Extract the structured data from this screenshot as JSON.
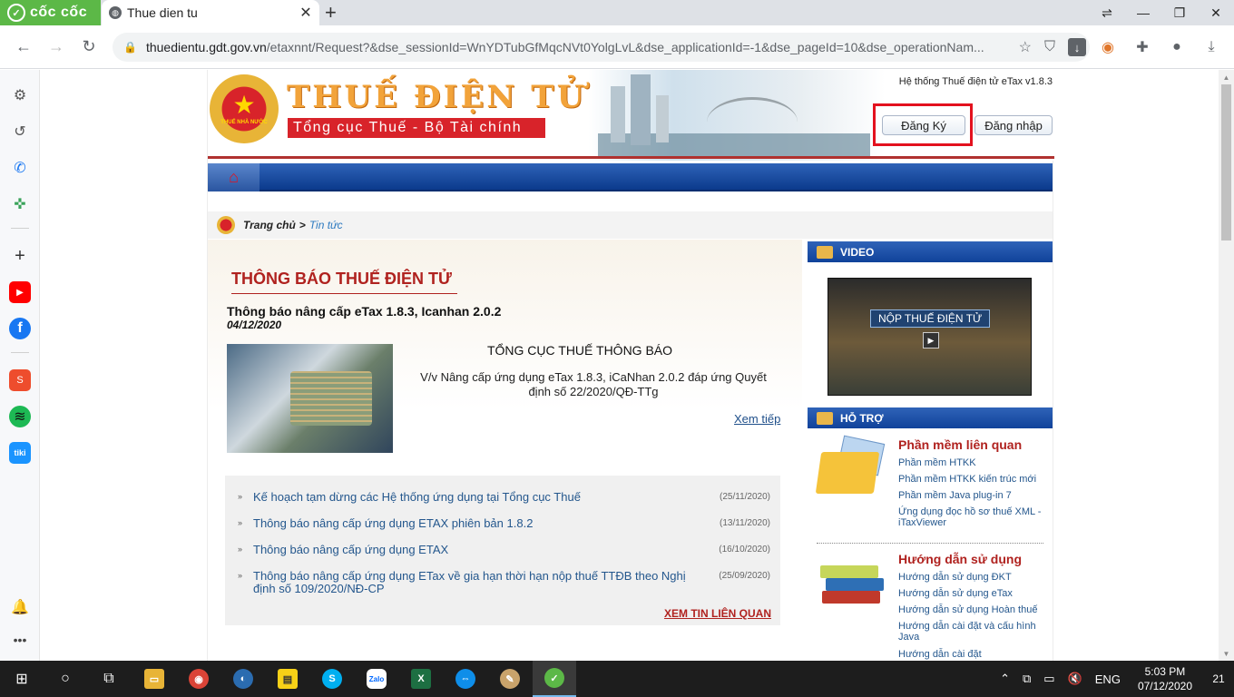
{
  "browser": {
    "brand": "cốc cốc",
    "tab_title": "Thue dien tu",
    "url_host": "thuedientu.gdt.gov.vn",
    "url_path": "/etaxnnt/Request?&dse_sessionId=WnYDTubGfMqcNVt0YolgLvL&dse_applicationId=-1&dse_pageId=10&dse_operationNam..."
  },
  "header": {
    "emblem_text": "THUẾ NHÀ NƯỚC",
    "site_title": "THUẾ ĐIỆN TỬ",
    "site_subtitle": "Tổng cục Thuế - Bộ Tài chính",
    "system_version": "Hệ thống Thuế điện tử eTax v1.8.3",
    "register_label": "Đăng Ký",
    "login_label": "Đăng nhập"
  },
  "breadcrumb": {
    "home": "Trang chủ",
    "separator": ">",
    "current": "Tin tức"
  },
  "main": {
    "section_title": "THÔNG BÁO THUẾ ĐIỆN TỬ",
    "featured": {
      "title": "Thông báo nâng cấp eTax 1.8.3, Icanhan 2.0.2",
      "date": "04/12/2020",
      "heading": "TỔNG CỤC THUẾ THÔNG BÁO",
      "body": "V/v Nâng cấp ứng dụng eTax 1.8.3, iCaNhan 2.0.2 đáp ứng Quyết định số 22/2020/QĐ-TTg",
      "more_label": "Xem tiếp"
    },
    "news": [
      {
        "title": "Kế hoạch tạm dừng các Hệ thống ứng dụng tại Tổng cục Thuế",
        "date": "(25/11/2020)"
      },
      {
        "title": "Thông báo nâng cấp ứng dụng ETAX phiên bản 1.8.2",
        "date": "(13/11/2020)"
      },
      {
        "title": "Thông báo nâng cấp ứng dụng ETAX",
        "date": "(16/10/2020)"
      },
      {
        "title": "Thông báo nâng cấp ứng dụng ETax về gia hạn thời hạn nộp thuế TTĐB theo Nghị định số 109/2020/NĐ-CP",
        "date": "(25/09/2020)"
      }
    ],
    "see_related_label": "XEM TIN LIÊN QUAN"
  },
  "right": {
    "video_title": "VIDEO",
    "video_caption": "NỘP THUẾ ĐIỆN TỬ",
    "support_title": "HỖ TRỢ",
    "software": {
      "title": "Phần mềm liên quan",
      "links": [
        "Phần mềm HTKK",
        "Phần mềm HTKK kiến trúc mới",
        "Phần mềm Java plug-in 7",
        "Ứng dụng đọc hồ sơ thuế XML - iTaxViewer"
      ]
    },
    "guide": {
      "title": "Hướng dẫn sử dụng",
      "links": [
        "Hướng dẫn sử dụng ĐKT",
        "Hướng dẫn sử dụng eTax",
        "Hướng dẫn sử dụng Hoàn thuế",
        "Hướng dẫn cài đặt và cấu hình Java",
        "Hướng dẫn cài đặt"
      ]
    }
  },
  "taskbar": {
    "language": "ENG",
    "time": "5:03 PM",
    "date": "07/12/2020",
    "notifications": "21"
  },
  "colors": {
    "brand_green": "#5cb847",
    "nav_blue": "#10429a",
    "accent_red": "#b0221f",
    "highlight_red": "#e3111e",
    "link_blue": "#24578d"
  }
}
